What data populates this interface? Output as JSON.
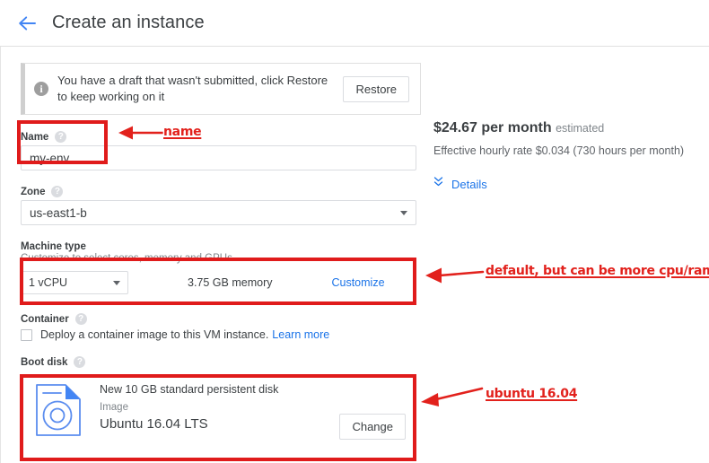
{
  "header": {
    "title": "Create an instance",
    "back_icon": "arrow-left-icon"
  },
  "banner": {
    "icon": "info-icon",
    "message": "You have a draft that wasn't submitted, click Restore to keep working on it",
    "restore_label": "Restore"
  },
  "form": {
    "name": {
      "label": "Name",
      "help_icon": "help-circle-icon",
      "value": "my-env"
    },
    "zone": {
      "label": "Zone",
      "help_icon": "help-circle-icon",
      "value": "us-east1-b",
      "dropdown_icon": "chevron-down-icon"
    },
    "machine_type": {
      "label": "Machine type",
      "description": "Customize to select cores, memory and GPUs.",
      "cpu_value": "1 vCPU",
      "cpu_dropdown_icon": "chevron-down-icon",
      "memory_text": "3.75 GB memory",
      "customize_label": "Customize"
    },
    "container": {
      "label": "Container",
      "help_icon": "help-circle-icon",
      "checkbox_checked": false,
      "checkbox_label": "Deploy a container image to this VM instance.",
      "learn_more_label": "Learn more"
    },
    "boot_disk": {
      "label": "Boot disk",
      "help_icon": "help-circle-icon",
      "disk_icon": "disk-image-icon",
      "title": "New 10 GB standard persistent disk",
      "subtitle": "Image",
      "os": "Ubuntu 16.04 LTS",
      "change_label": "Change"
    }
  },
  "pricing": {
    "amount": "$24.67 per month",
    "estimated_label": "estimated",
    "hourly_rate": "Effective hourly rate $0.034 (730 hours per month)",
    "details_label": "Details",
    "details_icon": "expand-more-double-icon"
  },
  "annotations": {
    "accent_color": "#e2211c",
    "name_note": "name",
    "machine_note": "default, but can be more cpu/ram",
    "bootdisk_note": "ubuntu 16.04"
  }
}
